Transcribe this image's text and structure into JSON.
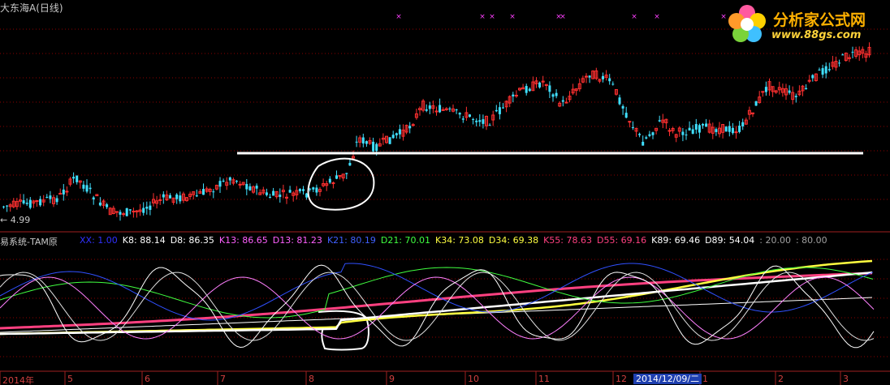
{
  "window": {
    "title": "大东海A(日线)"
  },
  "price_panel": {
    "low_marker": "← 4.99",
    "colors": {
      "up": "#ff3030",
      "down": "#40e0ff",
      "support_line": "#ffffff",
      "grid": "#8b0000",
      "signal": "#ff40ff"
    }
  },
  "indicator_panel": {
    "title": "易系统-TAM原",
    "values": [
      {
        "label": "XX: 1.00",
        "color": "#3030ff"
      },
      {
        "label": "K8: 88.14",
        "color": "#ffffff"
      },
      {
        "label": "D8: 86.35",
        "color": "#ffffff"
      },
      {
        "label": "K13: 86.65",
        "color": "#ff60ff"
      },
      {
        "label": "D13: 81.23",
        "color": "#ff60ff"
      },
      {
        "label": "K21: 80.19",
        "color": "#4060ff"
      },
      {
        "label": "D21: 70.01",
        "color": "#40ff40"
      },
      {
        "label": "K34: 73.08",
        "color": "#ffff40"
      },
      {
        "label": "D34: 69.38",
        "color": "#ffff40"
      },
      {
        "label": "K55: 78.63",
        "color": "#ff4080"
      },
      {
        "label": "D55: 69.16",
        "color": "#ff4080"
      },
      {
        "label": "K89: 69.46",
        "color": "#ffffff"
      },
      {
        "label": "D89: 54.04",
        "color": "#ffffff"
      },
      {
        "label": ": 20.00",
        "color": "#a0a0a0"
      },
      {
        "label": ": 80.00",
        "color": "#a0a0a0"
      }
    ]
  },
  "time_axis": {
    "labels": [
      "2014年",
      "5",
      "6",
      "7",
      "8",
      "9",
      "10",
      "11",
      "12",
      "1",
      "2",
      "3"
    ],
    "cursor_date": "2014/12/09/二"
  },
  "logo": {
    "name": "分析家公式网",
    "url": "www.88gs.com"
  }
}
